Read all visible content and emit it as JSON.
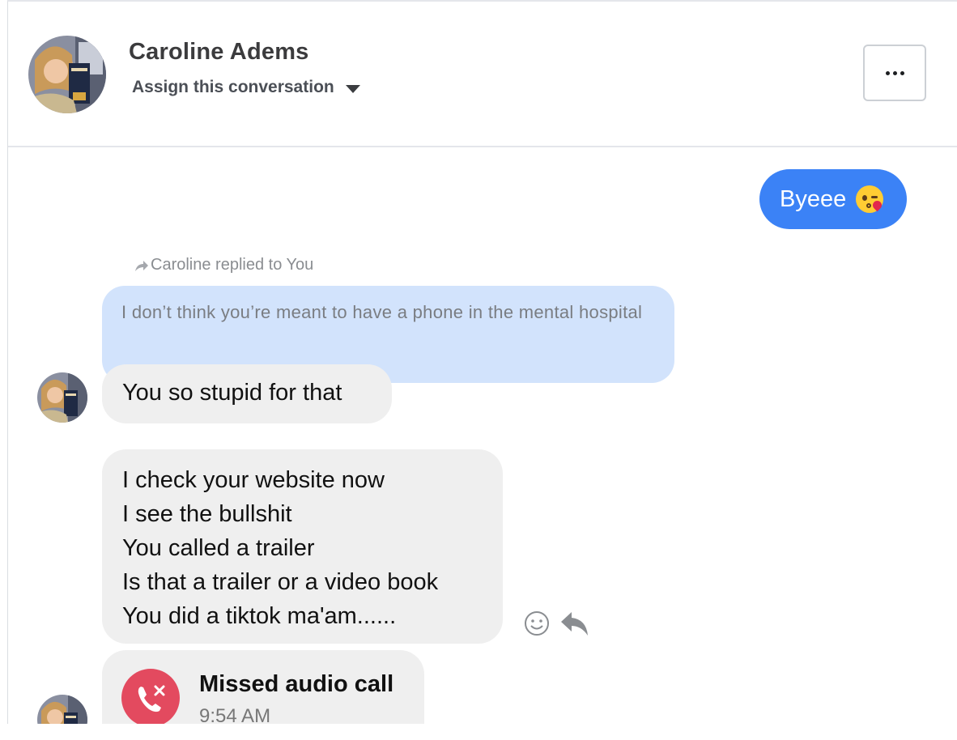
{
  "header": {
    "contact_name": "Caroline Adems",
    "assign_label": "Assign this conversation",
    "more_icon": "more-horizontal-icon"
  },
  "messages": {
    "outgoing": {
      "text": "Byeee",
      "emoji": "kissing-wink-heart-emoji"
    },
    "reply_context": {
      "label": "Caroline replied to You",
      "icon": "reply-arrow-icon"
    },
    "quoted": {
      "text": "I don’t think you’re meant to have a phone in the mental hospital"
    },
    "incoming_1": {
      "text": "You so stupid for that"
    },
    "incoming_2": {
      "lines": [
        "I check your website now",
        "I see the bullshit",
        "You called a trailer",
        "Is that a trailer or a video book",
        "You did a tiktok ma'am......"
      ]
    },
    "missed_call": {
      "title": "Missed audio call",
      "time": "9:54 AM",
      "icon": "missed-call-icon"
    }
  },
  "actions": {
    "react_icon": "smiley-icon",
    "reply_icon": "reply-icon"
  },
  "colors": {
    "outgoing_bubble": "#3b82f6",
    "incoming_bubble": "#efefef",
    "quote_bubble": "#d2e3fc",
    "missed_call": "#e34a5f"
  }
}
